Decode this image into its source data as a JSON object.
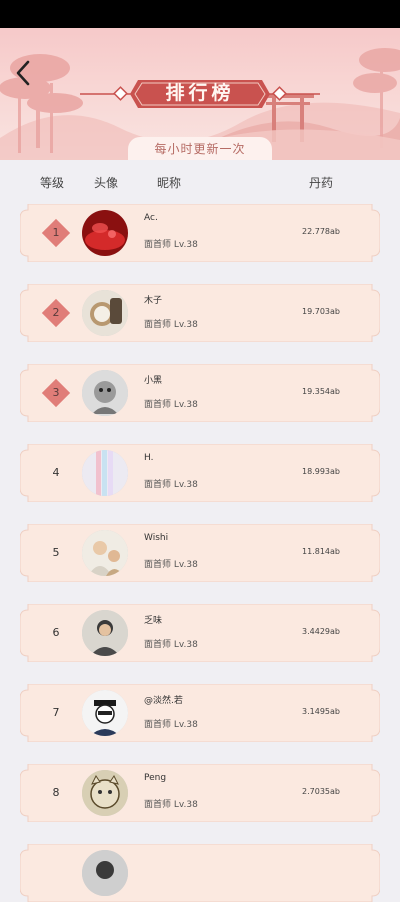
{
  "header": {
    "title": "排行榜",
    "subtitle": "每小时更新一次",
    "back_icon": "back-arrow-icon"
  },
  "columns": {
    "rank": "等级",
    "avatar": "头像",
    "nickname": "昵称",
    "pills": "丹药"
  },
  "colors": {
    "accent": "#c9524f",
    "badge": "#e07d78",
    "card": "#fbe9e0",
    "card_border": "#efcfc3"
  },
  "rows": [
    {
      "rank": "1",
      "nickname": "Ac.",
      "level": "面首师 Lv.38",
      "value": "22.778ab"
    },
    {
      "rank": "2",
      "nickname": "木子",
      "level": "面首师 Lv.38",
      "value": "19.703ab"
    },
    {
      "rank": "3",
      "nickname": "小黑",
      "level": "面首师 Lv.38",
      "value": "19.354ab"
    },
    {
      "rank": "4",
      "nickname": "H.",
      "level": "面首师 Lv.38",
      "value": "18.993ab"
    },
    {
      "rank": "5",
      "nickname": "Wishi",
      "level": "面首师 Lv.38",
      "value": "11.814ab"
    },
    {
      "rank": "6",
      "nickname": "乏味",
      "level": "面首师 Lv.38",
      "value": "3.4429ab"
    },
    {
      "rank": "7",
      "nickname": "@淡然.若",
      "level": "面首师 Lv.38",
      "value": "3.1495ab"
    },
    {
      "rank": "8",
      "nickname": "Peng",
      "level": "面首师 Lv.38",
      "value": "2.7035ab"
    }
  ]
}
